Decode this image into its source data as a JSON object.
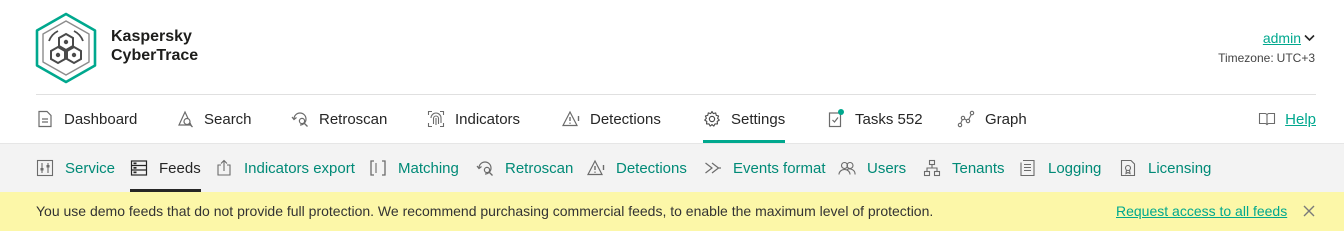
{
  "header": {
    "brand_line1": "Kaspersky",
    "brand_line2": "CyberTrace",
    "user": "admin",
    "timezone_label": "Timezone:",
    "timezone_value": "UTC+3"
  },
  "colors": {
    "accent": "#00a88e",
    "banner_bg": "#fcf7a8",
    "subnav_bg": "#f3f3f3",
    "text": "#262626"
  },
  "mainnav": {
    "items": [
      {
        "label": "Dashboard",
        "icon": "document-icon"
      },
      {
        "label": "Search",
        "icon": "search-icon"
      },
      {
        "label": "Retroscan",
        "icon": "retroscan-icon"
      },
      {
        "label": "Indicators",
        "icon": "fingerprint-icon"
      },
      {
        "label": "Detections",
        "icon": "warning-icon"
      },
      {
        "label": "Settings",
        "icon": "gear-icon",
        "active": true
      },
      {
        "label": "Tasks 552",
        "icon": "clipboard-check-icon",
        "badge": true
      },
      {
        "label": "Graph",
        "icon": "graph-icon"
      }
    ],
    "help": {
      "label": "Help",
      "icon": "book-icon"
    }
  },
  "subnav": {
    "items": [
      {
        "label": "Service",
        "icon": "sliders-icon"
      },
      {
        "label": "Feeds",
        "icon": "feeds-icon",
        "active": true
      },
      {
        "label": "Indicators export",
        "icon": "export-icon"
      },
      {
        "label": "Matching",
        "icon": "brackets-icon"
      },
      {
        "label": "Retroscan",
        "icon": "retroscan-icon"
      },
      {
        "label": "Detections",
        "icon": "warning-icon"
      },
      {
        "label": "Events format",
        "icon": "events-format-icon"
      },
      {
        "label": "Users",
        "icon": "users-icon"
      },
      {
        "label": "Tenants",
        "icon": "tenants-icon"
      },
      {
        "label": "Logging",
        "icon": "log-icon"
      },
      {
        "label": "Licensing",
        "icon": "license-icon"
      }
    ]
  },
  "banner": {
    "message": "You use demo feeds that do not provide full protection. We recommend purchasing commercial feeds, to enable the maximum level of protection.",
    "link": "Request access to all feeds"
  }
}
